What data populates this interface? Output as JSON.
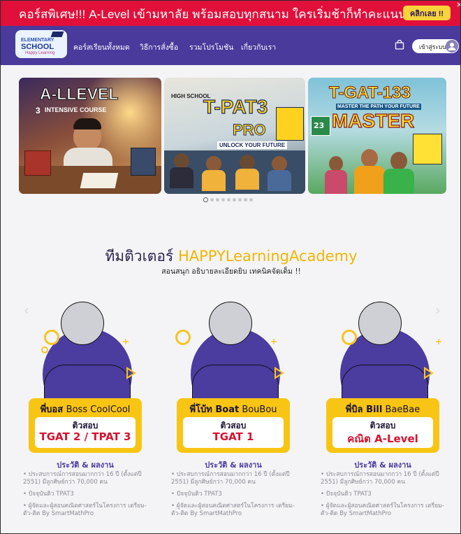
{
  "promo": {
    "text": "คอร์สพิเศษ!!! A-Level เข้ามหาลัย พร้อมสอบทุกสนาม ใครเริ่มช้าก็ทำคะแนนปังได้",
    "button": "คลิกเลย !!",
    "close": "×"
  },
  "header": {
    "logo": {
      "line1": "ELEMENTARY",
      "line2": "SCHOOL",
      "line3": "Happy Learning"
    },
    "nav": [
      "คอร์สเรียนทั้งหมด",
      "วิธีการสั่งซื้อ",
      "รวมโปรโมชัน",
      "เกี่ยวกับเรา"
    ],
    "login": "เข้าสู่ระบบ"
  },
  "slides": [
    {
      "title": "A-LLEVEL",
      "subtitle": "INTENSIVE COURSE",
      "number": "3"
    },
    {
      "title": "T-PAT3",
      "subtitle": "HIGH SCHOOL",
      "tagline": "UNLOCK YOUR FUTURE",
      "badge": "PRO"
    },
    {
      "title": "T-GAT-133",
      "subtitle": "MASTER THE PATH YOUR FUTURE",
      "badge": "MASTER",
      "number": "23"
    }
  ],
  "slider_dots": 9,
  "slider_active": 0,
  "team": {
    "title_part1": "ทีมติวเตอร์ ",
    "title_part2": "HAPPYLearningAcademy",
    "subtitle": "สอนสนุก อธิบายละเอียดยิบ เทคนิคจัดเต็ม !!",
    "arrow_left": "‹",
    "arrow_right": "›"
  },
  "tutors": [
    {
      "nick": "พี่บอส ",
      "name": "Boss CoolCool",
      "exam_label": "ติวสอบ",
      "exam": "TGAT 2 / TPAT 3",
      "section": "ประวัติ & ผลงาน",
      "history": [
        "ประสบการณ์การสอนมากกว่า 16 ปี (ตั้งแต่ปี 2551) มีลูกศิษย์กว่า 70,000 คน",
        "ปัจจุบันติว TPAT3",
        "ผู้จัดและผู้สอนคณิตศาสตร์ในโครงการ เตรียม-ตัว-ติด By SmartMathPro"
      ]
    },
    {
      "nick": "พี่โบ้ท ",
      "name": "Boat",
      "name_rest": " BouBou",
      "exam_label": "ติวสอบ",
      "exam": "TGAT 1",
      "section": "ประวัติ & ผลงาน",
      "history": [
        "ประสบการณ์การสอนมากกว่า 16 ปี (ตั้งแต่ปี 2551) มีลูกศิษย์กว่า 70,000 คน",
        "ปัจจุบันติว TPAT3",
        "ผู้จัดและผู้สอนคณิตศาสตร์ในโครงการ เตรียม-ตัว-ติด By SmartMathPro"
      ]
    },
    {
      "nick": "พี่บิล ",
      "name": "Bill",
      "name_rest": " BaeBae",
      "exam_label": "ติวสอบ",
      "exam": "คณิต A-Level",
      "section": "ประวัติ & ผลงาน",
      "history": [
        "ประสบการณ์การสอนมากกว่า 16 ปี (ตั้งแต่ปี 2551) มีลูกศิษย์กว่า 70,000 คน",
        "ปัจจุบันติว TPAT3",
        "ผู้จัดและผู้สอนคณิตศาสตร์ในโครงการ เตรียม-ตัว-ติด By SmartMathPro"
      ]
    }
  ],
  "colors": {
    "promo": "#e0103a",
    "header": "#493a9c",
    "accent_yellow": "#f8c514",
    "exam_red": "#d8102e",
    "purple": "#4b3ca0"
  }
}
